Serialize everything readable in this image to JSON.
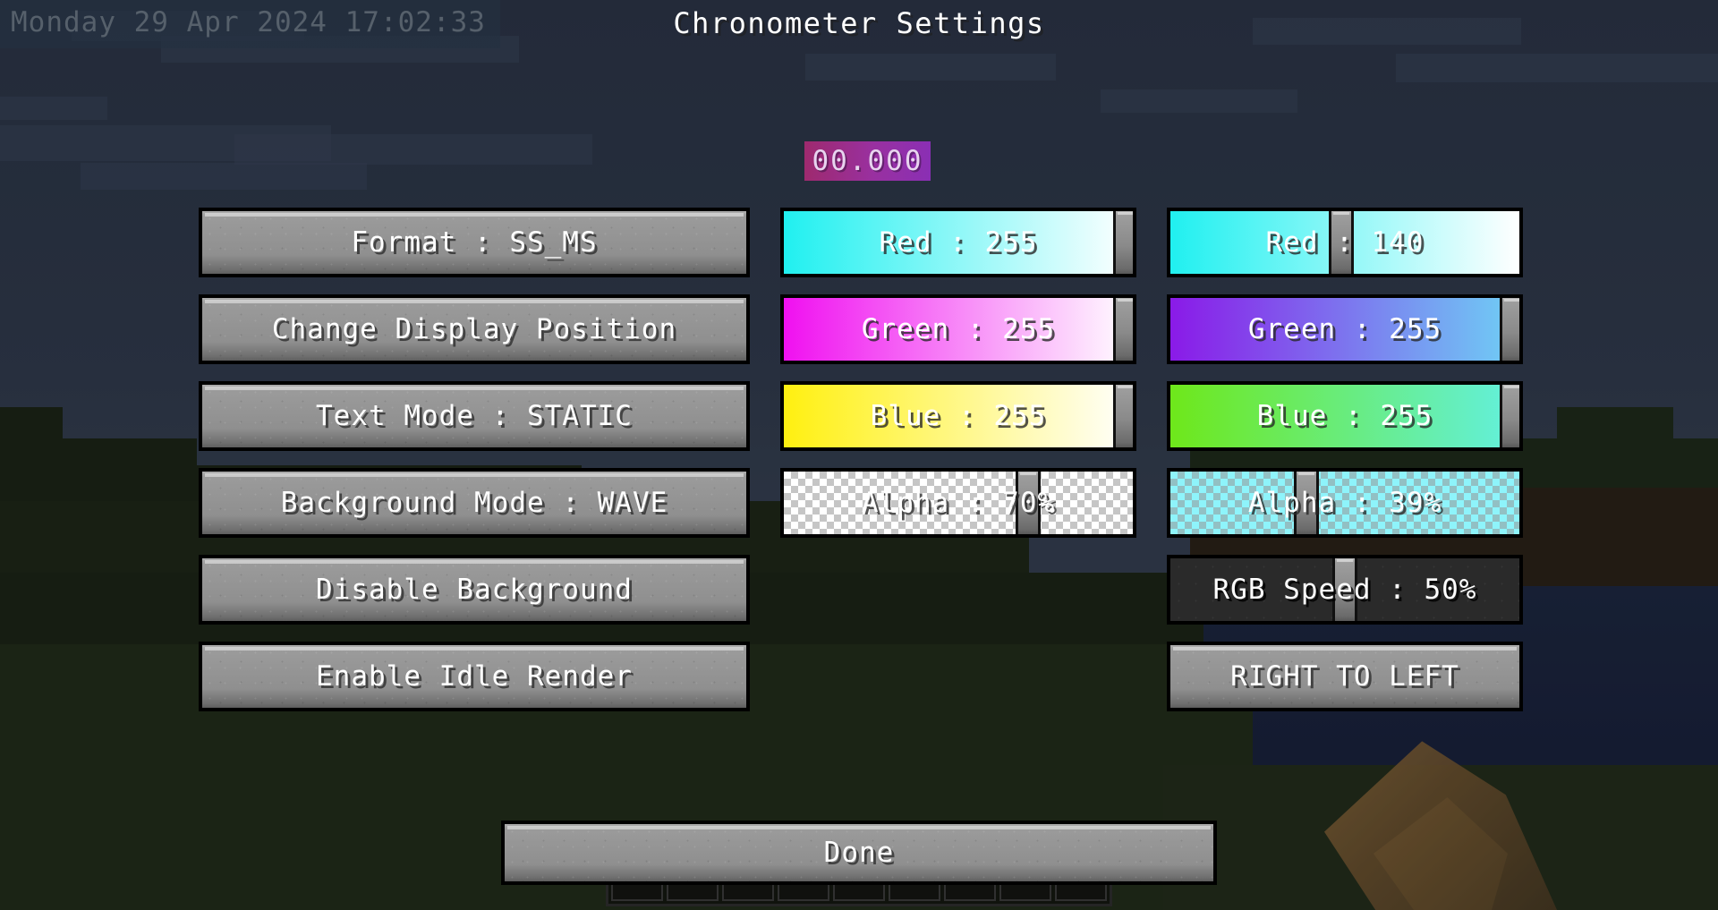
{
  "hud": {
    "datetime": "Monday 29 Apr 2024 17:02:33"
  },
  "screen": {
    "title": "Chronometer Settings"
  },
  "timer": {
    "value": "00.000",
    "bg_start": "#9e2a6e",
    "bg_end": "#8a2fb4",
    "text_color": "#e8d4ef"
  },
  "left_column": [
    {
      "name": "format",
      "label": "Format : SS_MS"
    },
    {
      "name": "change-position",
      "label": "Change Display Position"
    },
    {
      "name": "text-mode",
      "label": "Text Mode : STATIC"
    },
    {
      "name": "background-mode",
      "label": "Background Mode : WAVE"
    },
    {
      "name": "disable-background",
      "label": "Disable Background"
    },
    {
      "name": "enable-idle-render",
      "label": "Enable Idle Render"
    }
  ],
  "middle_column": [
    {
      "name": "text-red",
      "label": "Red : 255",
      "value": 255,
      "max": 255,
      "percent": 100,
      "gradient_start": "#20f0f0",
      "gradient_end": "#ffffff",
      "kind": "slider"
    },
    {
      "name": "text-green",
      "label": "Green : 255",
      "value": 255,
      "max": 255,
      "percent": 100,
      "gradient_start": "#f010f0",
      "gradient_end": "#ffffff",
      "kind": "slider"
    },
    {
      "name": "text-blue",
      "label": "Blue : 255",
      "value": 255,
      "max": 255,
      "percent": 100,
      "gradient_start": "#fff010",
      "gradient_end": "#ffffff",
      "kind": "slider"
    },
    {
      "name": "text-alpha",
      "label": "Alpha : 70%",
      "value": 70,
      "max": 100,
      "percent": 70,
      "gradient_start": "#ffffff",
      "gradient_end": "#ffffff",
      "kind": "alpha"
    }
  ],
  "right_column": [
    {
      "name": "bg-red",
      "label": "Red : 140",
      "value": 140,
      "max": 255,
      "percent": 49,
      "gradient_start": "#20f0f0",
      "gradient_end": "#ffffff",
      "kind": "slider"
    },
    {
      "name": "bg-green",
      "label": "Green : 255",
      "value": 255,
      "max": 255,
      "percent": 100,
      "gradient_start": "#8a1ae8",
      "gradient_end": "#6fd0f5",
      "kind": "slider"
    },
    {
      "name": "bg-blue",
      "label": "Blue : 255",
      "value": 255,
      "max": 255,
      "percent": 100,
      "gradient_start": "#6ee81a",
      "gradient_end": "#63f0e0",
      "kind": "slider"
    },
    {
      "name": "bg-alpha",
      "label": "Alpha : 39%",
      "value": 39,
      "max": 100,
      "percent": 39,
      "gradient_start": "#8ef4fb",
      "gradient_end": "#8ef4fb",
      "kind": "alpha"
    },
    {
      "name": "rgb-speed",
      "label": "RGB Speed : 50%",
      "value": 50,
      "max": 100,
      "percent": 50,
      "gradient_start": "#2a2a2a",
      "gradient_end": "#2a2a2a",
      "kind": "dark-slider"
    },
    {
      "name": "direction",
      "label": "RIGHT TO LEFT",
      "kind": "button"
    }
  ],
  "done": {
    "label": "Done"
  }
}
